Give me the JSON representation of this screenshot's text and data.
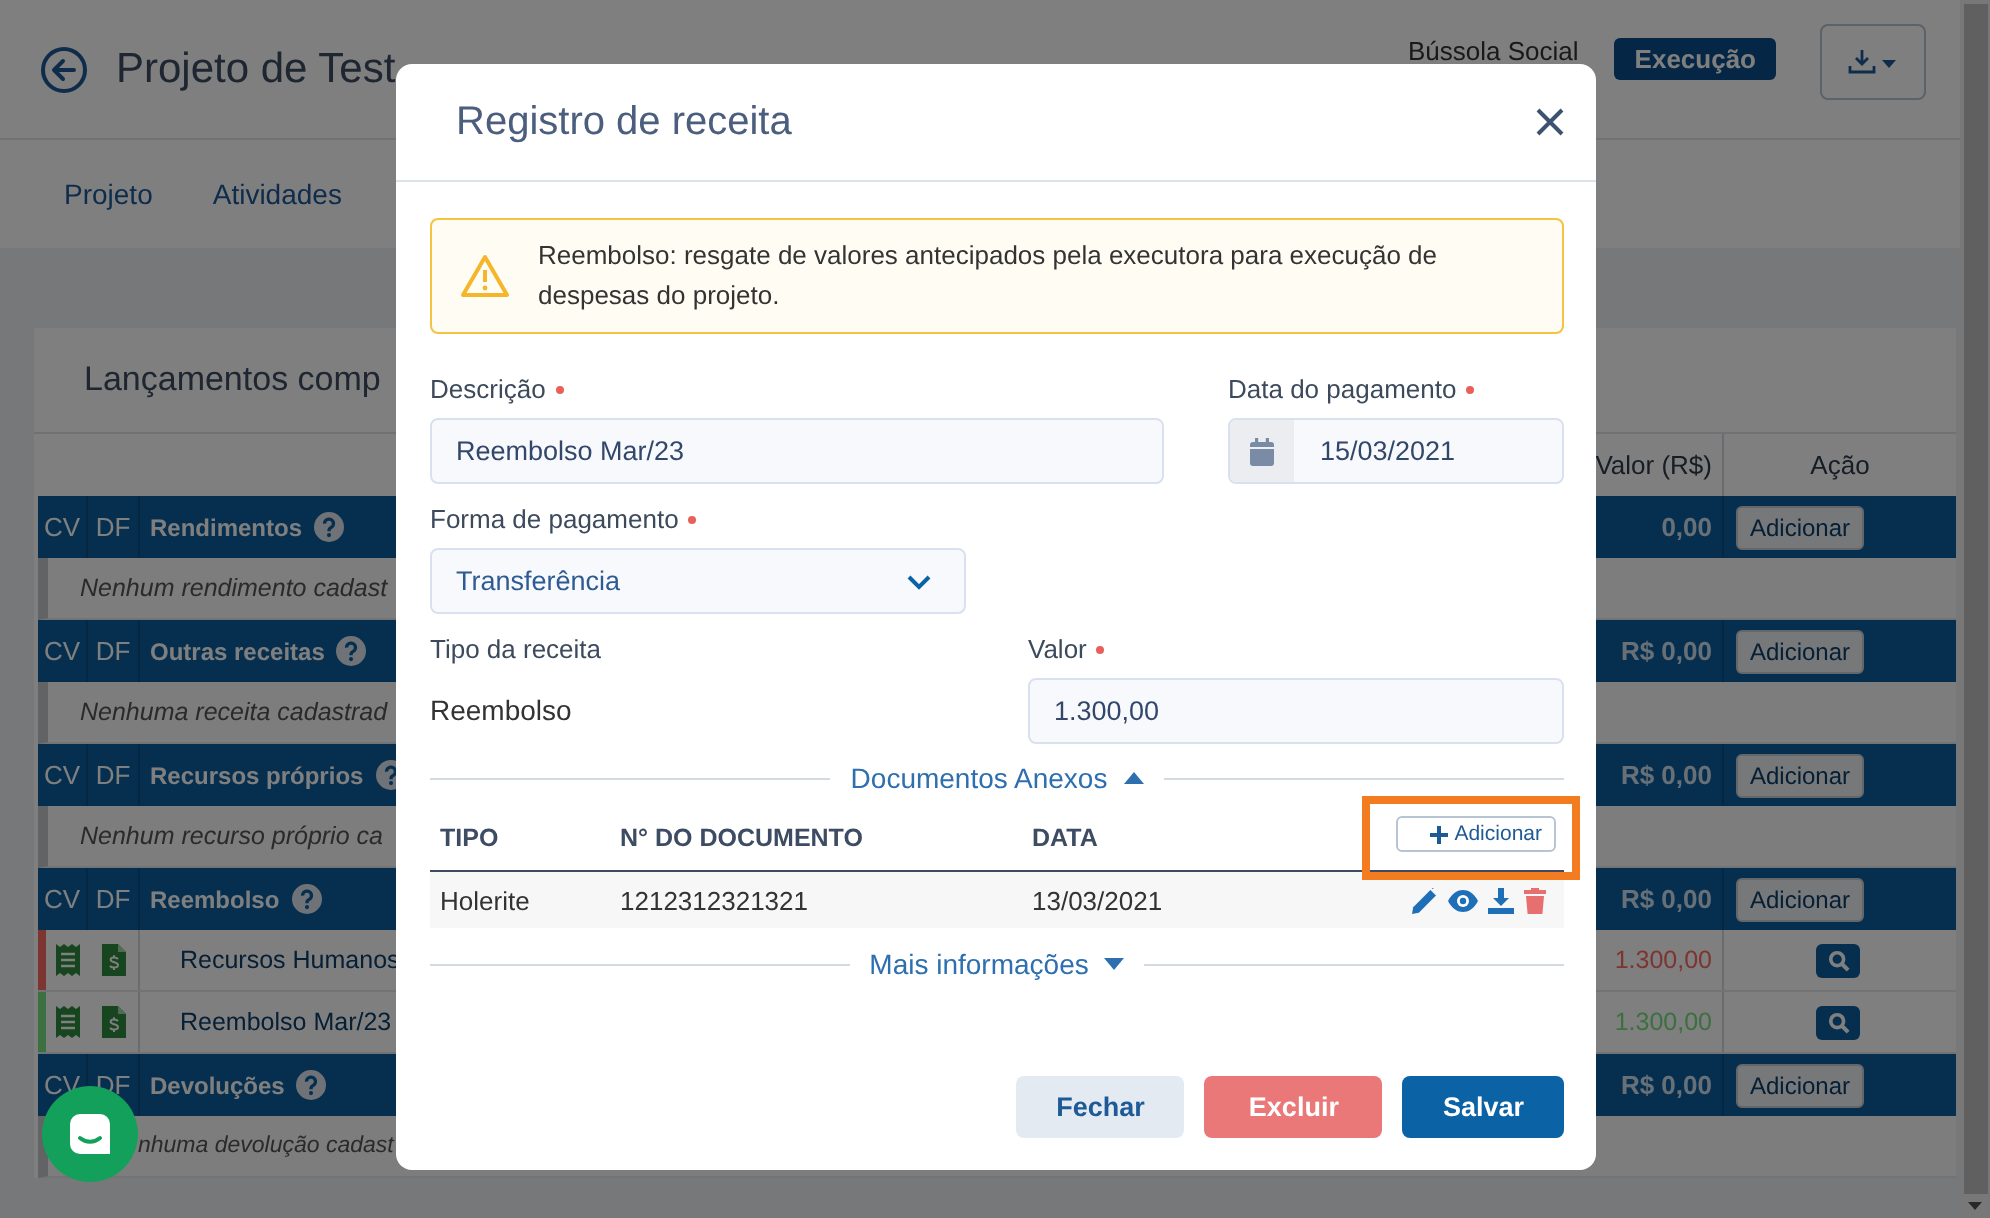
{
  "header": {
    "title": "Projeto de Test",
    "organization": "Bússola Social",
    "status": "Execução"
  },
  "nav": [
    {
      "label": "Projeto"
    },
    {
      "label": "Atividades"
    }
  ],
  "card": {
    "title": "Lançamentos comp",
    "columns": [
      "Valor (R$)",
      "Ação"
    ],
    "sections": [
      {
        "cv": "CV",
        "df": "DF",
        "name": "Rendimentos",
        "value": "0,00",
        "action": "Adicionar",
        "empty_message": "Nenhum rendimento cadast"
      },
      {
        "cv": "CV",
        "df": "DF",
        "name": "Outras receitas",
        "value": "R$ 0,00",
        "action": "Adicionar",
        "empty_message": "Nenhuma receita cadastrad"
      },
      {
        "cv": "CV",
        "df": "DF",
        "name": "Recursos próprios",
        "value": "R$ 0,00",
        "action": "Adicionar",
        "empty_message": "Nenhum recurso próprio ca"
      },
      {
        "cv": "CV",
        "df": "DF",
        "name": "Reembolso",
        "value": "R$ 0,00",
        "action": "Adicionar",
        "items": [
          {
            "name": "Recursos Humanos",
            "value": "1.300,00",
            "color": "#7c3530"
          },
          {
            "name": "Reembolso Mar/23",
            "value": "1.300,00",
            "color": "#3c7040"
          }
        ]
      },
      {
        "cv": "CV",
        "df": "DF",
        "name": "Devoluções",
        "value": "R$ 0,00",
        "action": "Adicionar",
        "empty_message": "nhuma devolução cadast"
      }
    ]
  },
  "modal": {
    "title": "Registro de receita",
    "alert": "Reembolso: resgate de valores antecipados pela executora para execução de despesas do projeto.",
    "description": {
      "label": "Descrição",
      "required": true,
      "value": "Reembolso Mar/23"
    },
    "payment_date": {
      "label": "Data do pagamento",
      "required": true,
      "value": "15/03/2021"
    },
    "payment_method": {
      "label": "Forma de pagamento",
      "required": true,
      "value": "Transferência"
    },
    "revenue_type": {
      "label": "Tipo da receita",
      "value": "Reembolso"
    },
    "amount": {
      "label": "Valor",
      "required": true,
      "value": "1.300,00"
    },
    "documents": {
      "title": "Documentos Anexos",
      "expanded": true,
      "columns": [
        "TIPO",
        "N° DO DOCUMENTO",
        "DATA"
      ],
      "add_button": {
        "label": "Adicionar",
        "highlighted": true
      },
      "rows": [
        {
          "type": "Holerite",
          "number": "1212312321321",
          "date": "13/03/2021"
        }
      ]
    },
    "more_info": {
      "title": "Mais informações",
      "expanded": false
    },
    "buttons": [
      {
        "label": "Fechar",
        "kind": "secondary"
      },
      {
        "label": "Excluir",
        "kind": "danger"
      },
      {
        "label": "Salvar",
        "kind": "primary"
      }
    ]
  }
}
